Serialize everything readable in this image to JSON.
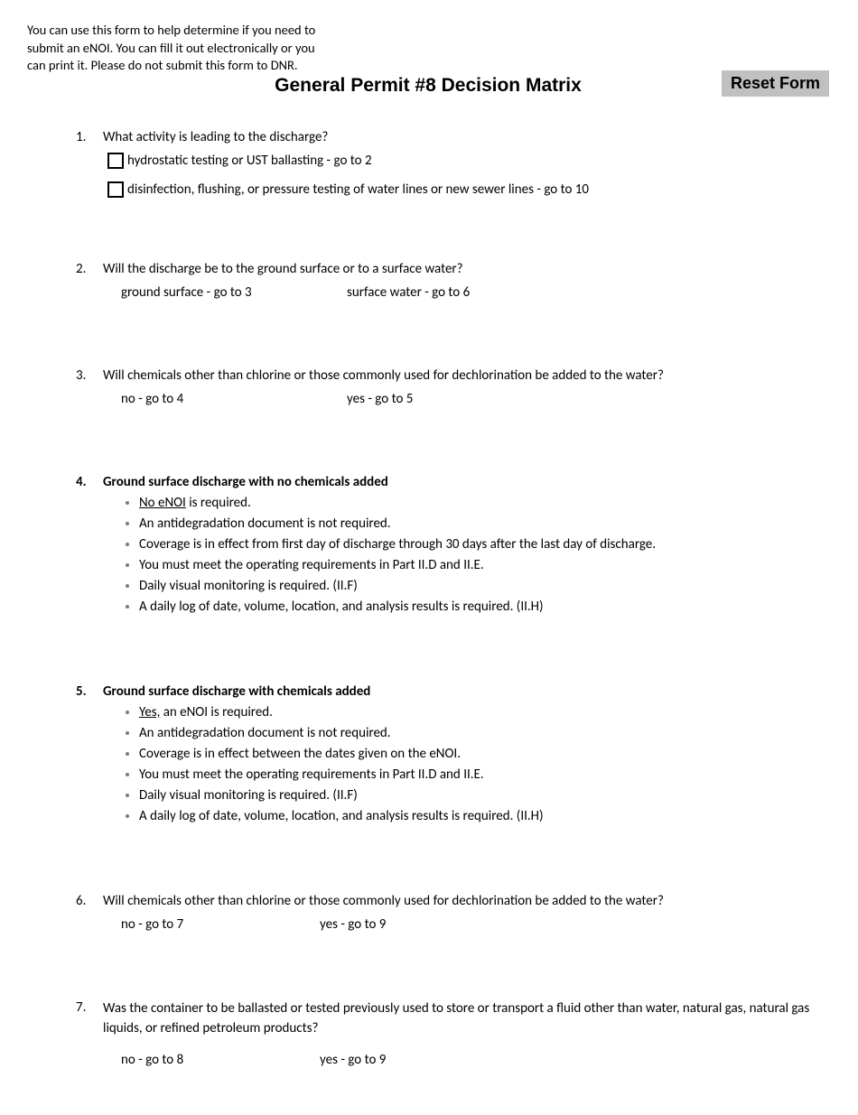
{
  "header": {
    "intro": "You can use this form to help determine if you need to submit an eNOI. You can fill it out electronically or you can print it. Please do not submit this form to DNR.",
    "reset_label": "Reset Form",
    "title": "General Permit #8 Decision Matrix"
  },
  "q1": {
    "num": "1.",
    "text": "What activity is leading to the discharge?",
    "opt_a": "hydrostatic testing or UST ballasting - go to 2",
    "opt_b": "disinfection, flushing, or pressure testing of water lines or new sewer lines - go to 10"
  },
  "q2": {
    "num": "2.",
    "text": "Will the discharge be to the ground surface or to a surface water?",
    "opt_a": "ground surface - go to 3",
    "opt_b": "surface water - go to 6"
  },
  "q3": {
    "num": "3.",
    "text": "Will chemicals other than chlorine or those commonly used for dechlorination be added to the water?",
    "opt_a": "no - go to 4",
    "opt_b": "yes - go to 5"
  },
  "q4": {
    "num": "4.",
    "title": "Ground surface discharge with no chemicals added",
    "b1_u": "No eNOI",
    "b1_rest": " is required.",
    "b2": "An antidegradation document is not required.",
    "b3": "Coverage is in effect from first day of discharge through 30 days after the last day of discharge.",
    "b4": "You must meet the operating requirements in Part II.D and II.E.",
    "b5": "Daily visual monitoring is required. (II.F)",
    "b6": "A daily log of date, volume, location, and analysis results is required. (II.H)"
  },
  "q5": {
    "num": "5.",
    "title": "Ground surface discharge with chemicals added",
    "b1_u": "Yes,",
    "b1_rest": " an eNOI is required.",
    "b2": "An antidegradation document is not required.",
    "b3": "Coverage is in effect between the dates given on the eNOI.",
    "b4": "You must meet the operating requirements in Part II.D and II.E.",
    "b5": "Daily visual monitoring is required. (II.F)",
    "b6": "A daily log of date, volume, location, and analysis results is required. (II.H)"
  },
  "q6": {
    "num": "6.",
    "text": "Will chemicals other than chlorine or those commonly used for dechlorination be added to the water?",
    "opt_a": "no - go to 7",
    "opt_b": "yes - go to 9"
  },
  "q7": {
    "num": "7.",
    "text": "Was the container to be ballasted or tested previously used to store or transport a fluid other than water, natural gas, natural gas liquids, or refined petroleum products?",
    "opt_a": "no - go to 8",
    "opt_b": "yes - go to 9"
  }
}
